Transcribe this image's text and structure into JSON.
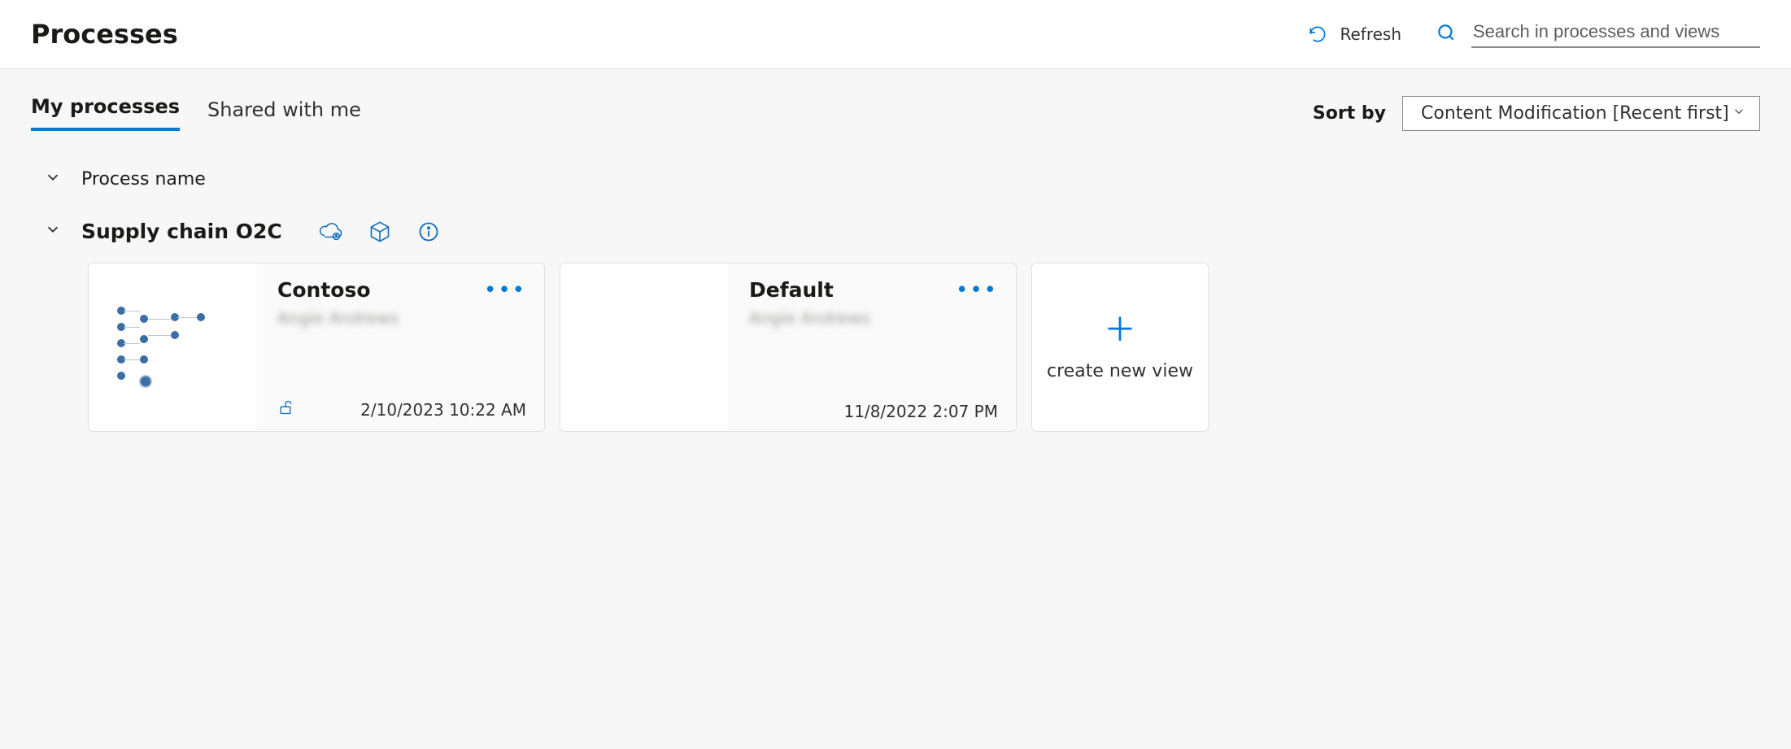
{
  "header": {
    "title": "Processes",
    "refresh_label": "Refresh",
    "search_placeholder": "Search in processes and views"
  },
  "tabs": {
    "my": "My processes",
    "shared": "Shared with me",
    "active": "my"
  },
  "sort": {
    "label": "Sort by",
    "selected": "Content Modification [Recent first]"
  },
  "columns": {
    "name": "Process name"
  },
  "process": {
    "name": "Supply chain O2C"
  },
  "cards": [
    {
      "title": "Contoso",
      "author": "Angie Andrews",
      "date": "2/10/2023 10:22 AM",
      "has_lock": true,
      "has_preview": true
    },
    {
      "title": "Default",
      "author": "Angie Andrews",
      "date": "11/8/2022 2:07 PM",
      "has_lock": false,
      "has_preview": false
    }
  ],
  "create_label": "create new view",
  "icons": {
    "refresh": "refresh-icon",
    "search": "search-icon",
    "chevron_down": "chevron-down-icon",
    "cloud_upload": "cloud-upload-icon",
    "package": "package-icon",
    "info": "info-icon",
    "lock": "lock-icon",
    "more": "more-icon",
    "plus": "plus-icon"
  }
}
